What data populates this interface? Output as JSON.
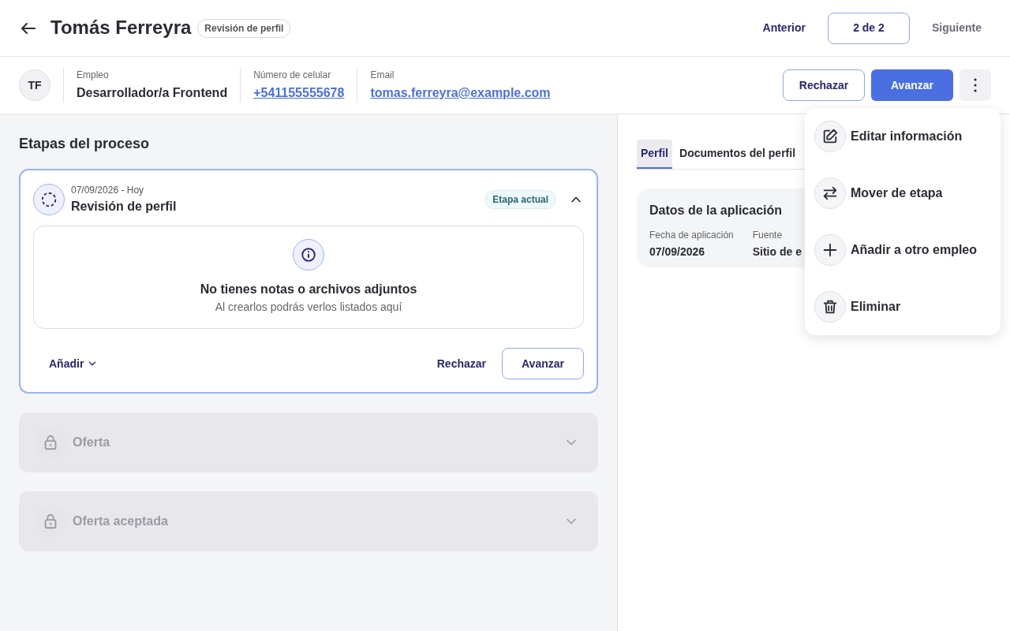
{
  "header": {
    "title": "Tomás Ferreyra",
    "status": "Revisión de perfil",
    "pagination": {
      "previous": {
        "label": "Anterior",
        "disabled": false
      },
      "current": "2 de 2",
      "next": {
        "label": "Siguiente",
        "disabled": true
      }
    }
  },
  "candidate": {
    "initials": "TF",
    "fields": [
      {
        "label": "Empleo",
        "value": "Desarrollador/a Frontend",
        "kind": "text"
      },
      {
        "label": "Número de celular",
        "value": "+541155555678",
        "kind": "link"
      },
      {
        "label": "Email",
        "value": "tomas.ferreyra@example.com",
        "kind": "link"
      }
    ],
    "reject": "Rechazar",
    "advance": "Avanzar",
    "menu_open": true
  },
  "stages_title": "Etapas del proceso",
  "stages": [
    {
      "kind": "current",
      "date": "07/09/2026 - Hoy",
      "title": "Revisión de perfil",
      "badge": "Etapa actual",
      "expanded": true,
      "empty_title": "No tienes notas o archivos adjuntos",
      "empty_text": "Al crearlos podrás verlos listados aquí",
      "add": "Añadir",
      "reject": "Rechazar",
      "advance": "Avanzar"
    },
    {
      "kind": "locked",
      "title": "Oferta",
      "expanded": false
    },
    {
      "kind": "locked",
      "title": "Oferta aceptada",
      "expanded": false
    }
  ],
  "tabs": [
    {
      "label": "Perfil",
      "selected": true
    },
    {
      "label": "Documentos del perfil",
      "selected": false
    }
  ],
  "application": {
    "title": "Datos de la aplicación",
    "fields": [
      {
        "label": "Fecha de aplicación",
        "value": "07/09/2026"
      },
      {
        "label": "Fuente",
        "value": "Sitio de e"
      }
    ]
  },
  "menu": [
    {
      "kind": "edit",
      "label": "Editar información"
    },
    {
      "kind": "move",
      "label": "Mover de etapa"
    },
    {
      "kind": "add",
      "label": "Añadir a otro empleo"
    },
    {
      "kind": "delete",
      "label": "Eliminar"
    }
  ]
}
